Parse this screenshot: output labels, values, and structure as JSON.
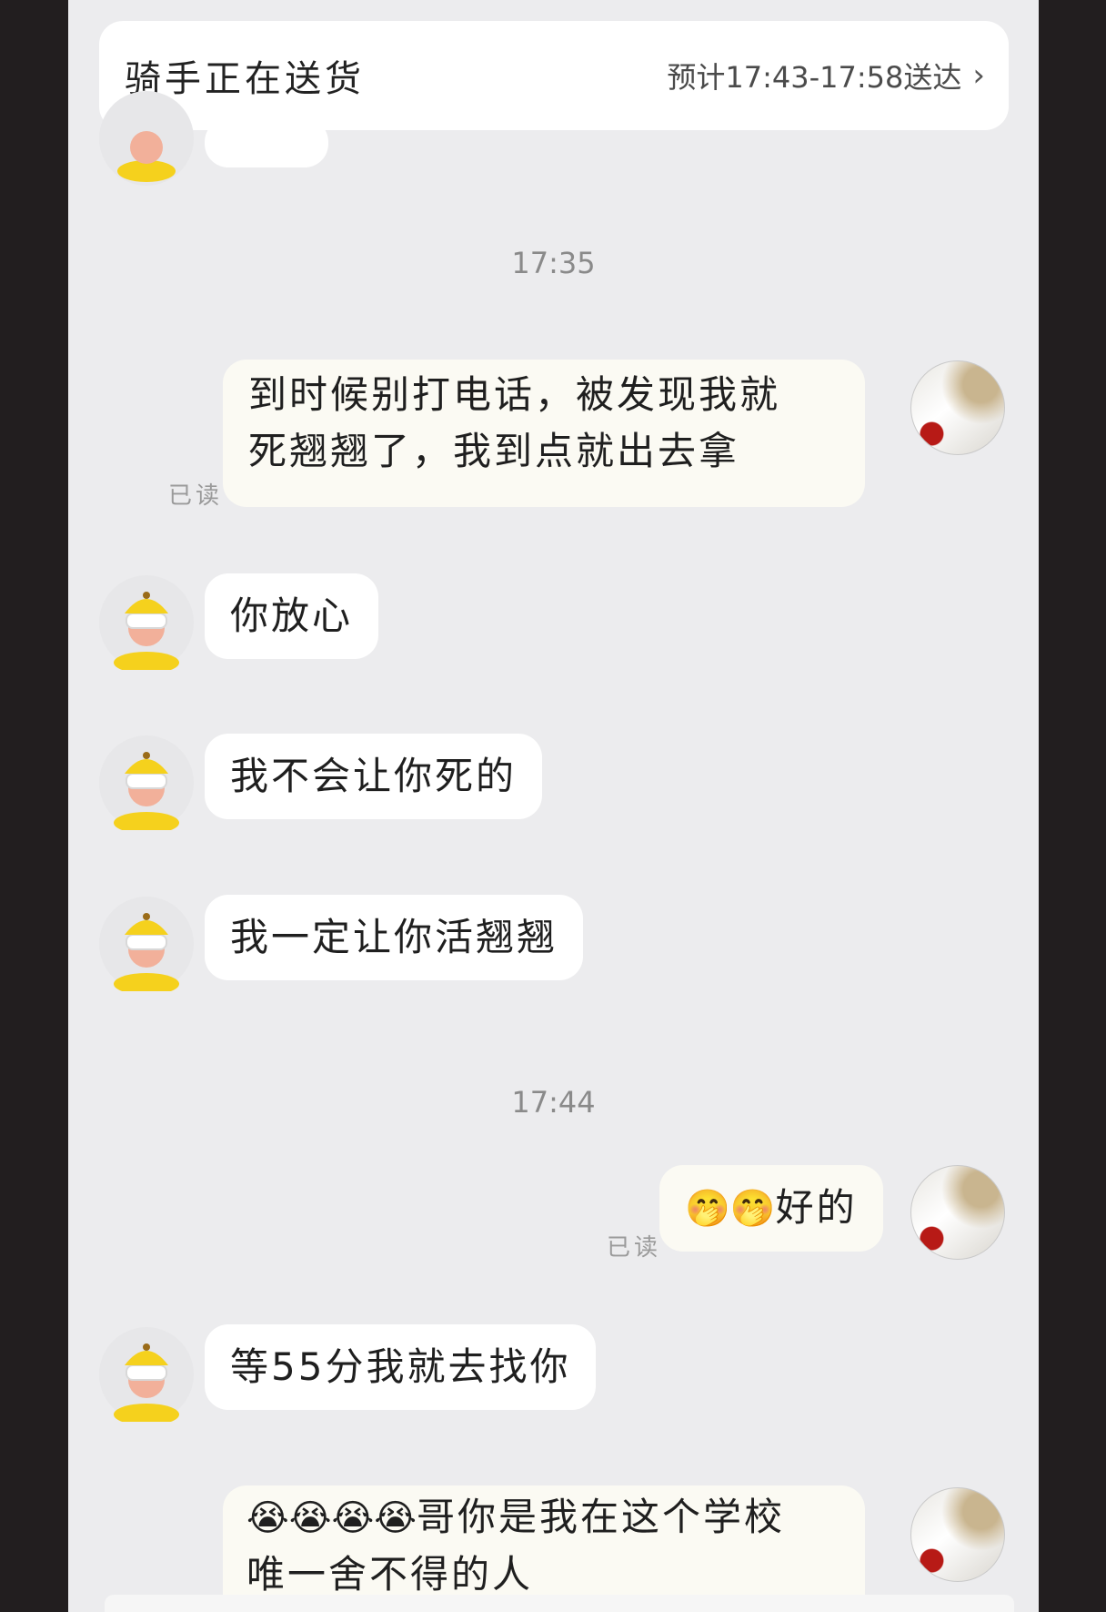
{
  "header": {
    "status": "骑手正在送货",
    "eta": "预计17:43-17:58送达"
  },
  "timestamps": [
    "17:35",
    "17:44"
  ],
  "read_label": "已读",
  "messages": [
    {
      "sender": "user",
      "text": "到时候别打电话，被发现我就死翘翘了，我到点就出去拿",
      "lines": [
        "到时候别打电话，被发现我就",
        "死翘翘了，我到点就出去拿"
      ]
    },
    {
      "sender": "rider",
      "text": "你放心"
    },
    {
      "sender": "rider",
      "text": "我不会让你死的"
    },
    {
      "sender": "rider",
      "text": "我一定让你活翘翘"
    },
    {
      "sender": "user",
      "emoji": "🤭🤭",
      "text": "好的"
    },
    {
      "sender": "rider",
      "text": "等55分我就去找你"
    },
    {
      "sender": "user",
      "emoji": "😭😭😭😭",
      "lines": [
        "哥你是我在这个学校",
        "唯一舍不得的人"
      ]
    }
  ],
  "icons": {
    "chevron": "chevron-right-icon",
    "rider_avatar": "rider-avatar-icon",
    "user_avatar": "user-avatar"
  }
}
